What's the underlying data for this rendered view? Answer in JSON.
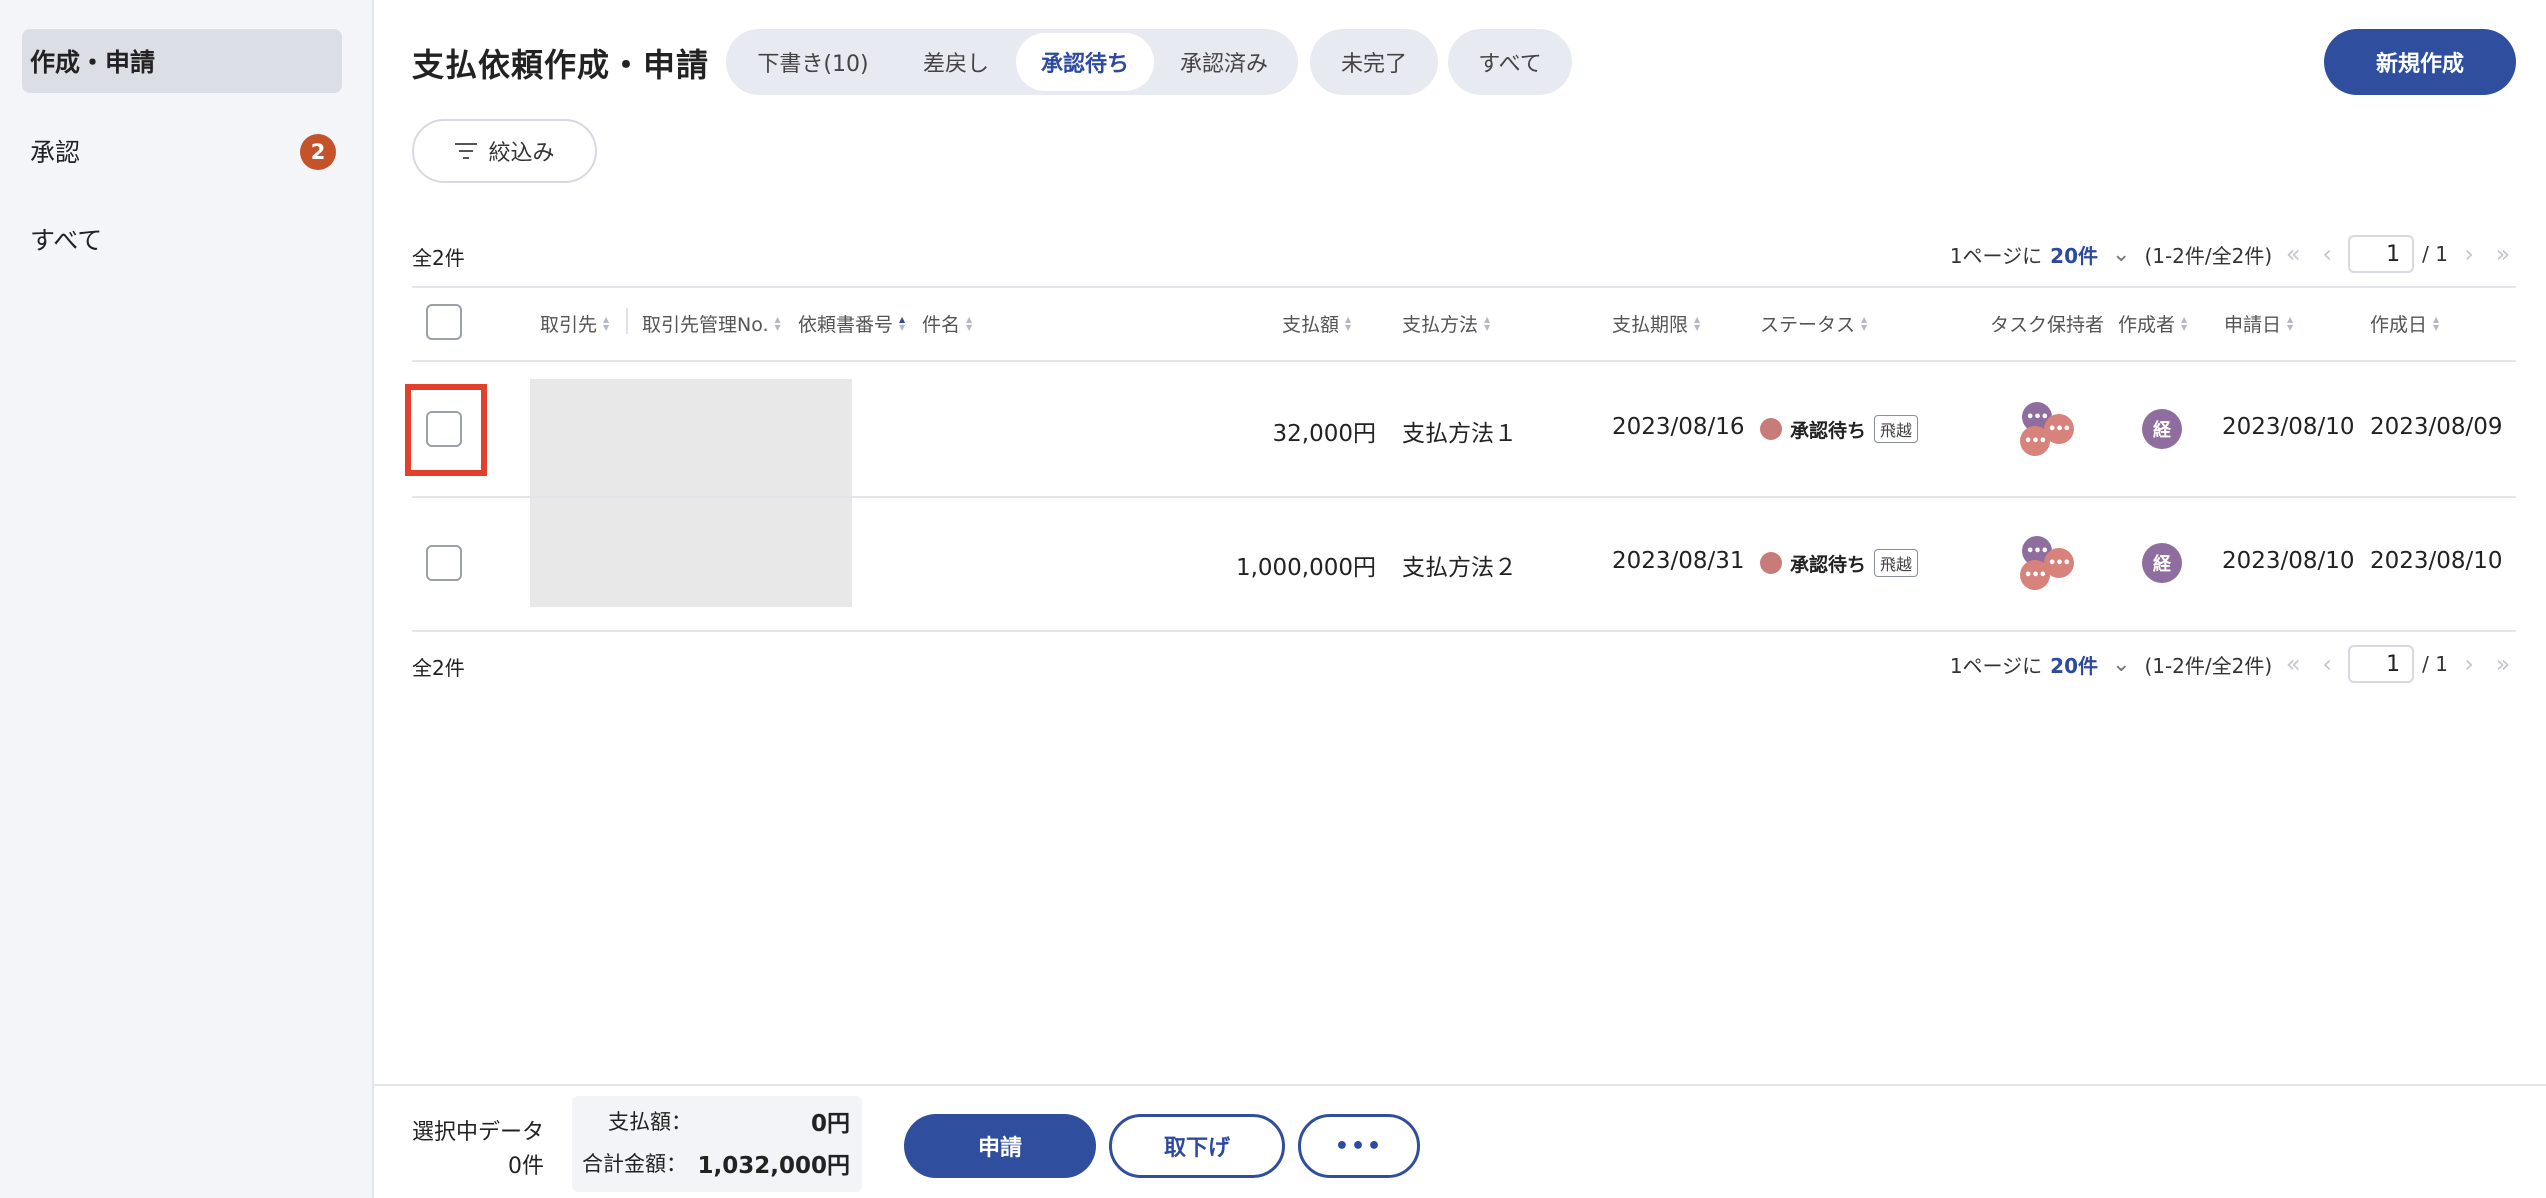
{
  "sidebar": {
    "items": [
      {
        "label": "作成・申請"
      },
      {
        "label": "承認",
        "badge": "2"
      },
      {
        "label": "すべて"
      }
    ]
  },
  "header": {
    "title": "支払依頼作成・申請",
    "tabs": [
      "下書き(10)",
      "差戻し",
      "承認待ち",
      "承認済み"
    ],
    "active_tab": "承認待ち",
    "extra_tabs": [
      "未完了",
      "すべて"
    ],
    "new_button": "新規作成",
    "filter_button": "絞込み"
  },
  "list": {
    "total": "全2件",
    "per_page_prefix": "1ページに",
    "per_page": "20件",
    "range": "(1-2件/全2件)",
    "page": "1",
    "page_total": "/ 1"
  },
  "table": {
    "columns": {
      "partner": "取引先",
      "partner_no": "取引先管理No.",
      "request_no": "依頼書番号",
      "subject": "件名",
      "amount": "支払額",
      "method": "支払方法",
      "due": "支払期限",
      "status": "ステータス",
      "task_holder": "タスク保持者",
      "creator": "作成者",
      "applied": "申請日",
      "created": "作成日"
    },
    "rows": [
      {
        "amount": "32,000円",
        "method": "支払方法１",
        "due": "2023/08/16",
        "status": "承認待ち",
        "tag": "飛越",
        "creator": "経",
        "applied": "2023/08/10",
        "created": "2023/08/09"
      },
      {
        "amount": "1,000,000円",
        "method": "支払方法２",
        "due": "2023/08/31",
        "status": "承認待ち",
        "tag": "飛越",
        "creator": "経",
        "applied": "2023/08/10",
        "created": "2023/08/10"
      }
    ],
    "avatar_dots": "•••"
  },
  "footer": {
    "selected_label": "選択中データ",
    "selected_count": "0件",
    "amount_label": "支払額：",
    "amount_value": "0円",
    "total_label": "合計金額：",
    "total_value": "1,032,000円",
    "apply_button": "申請",
    "withdraw_button": "取下げ",
    "more_button": "•••"
  },
  "colors": {
    "primary": "#2f4f9e",
    "badge": "#c4532a",
    "highlight": "#e2402a",
    "status_dot": "#c77c79"
  }
}
